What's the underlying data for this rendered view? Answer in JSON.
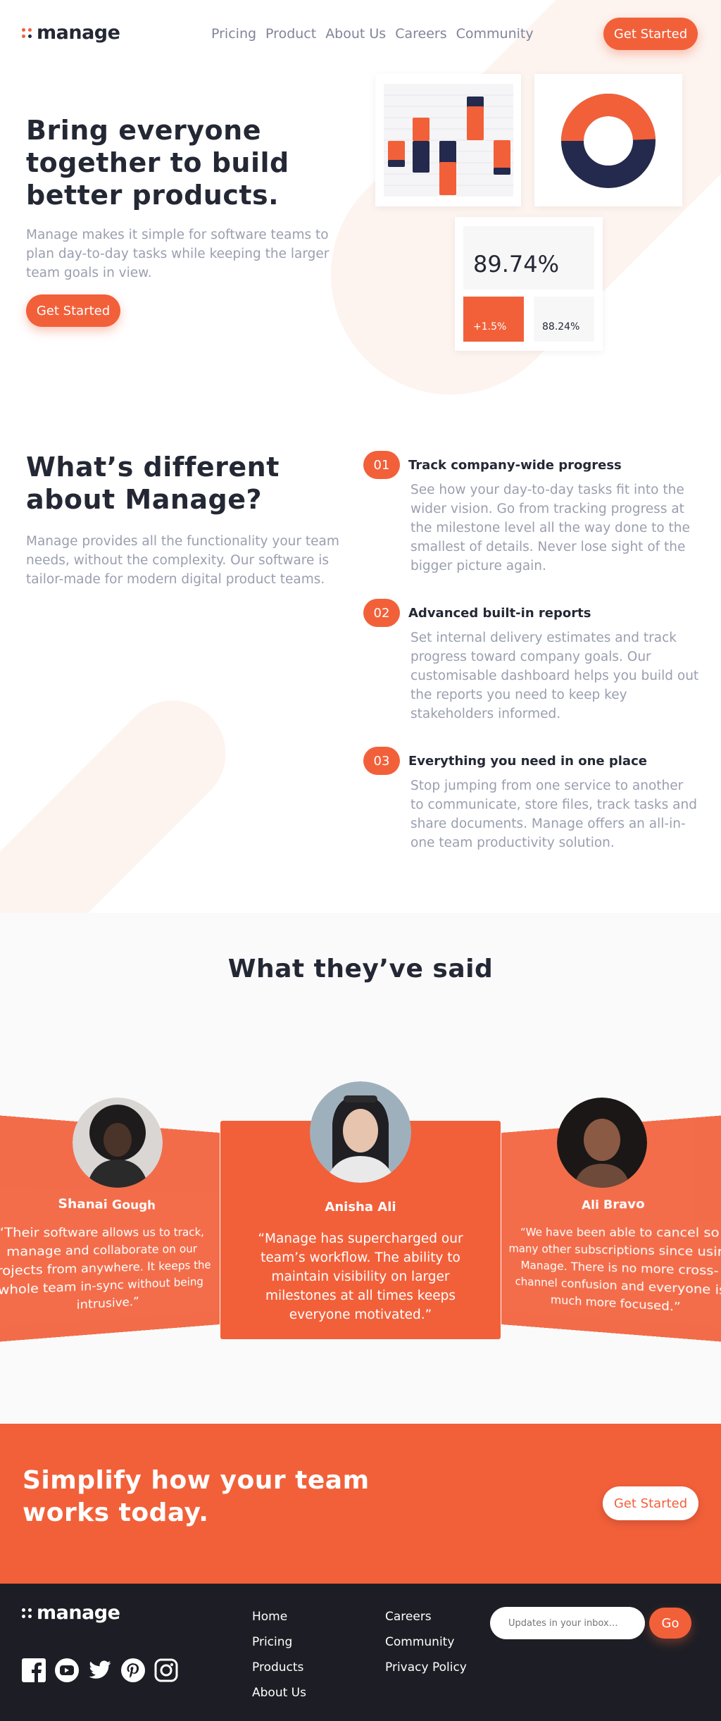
{
  "brand": {
    "name": "manage",
    "accent": "#f2603a",
    "dark": "#242835"
  },
  "nav": {
    "items": [
      "Pricing",
      "Product",
      "About Us",
      "Careers",
      "Community"
    ],
    "cta": "Get Started"
  },
  "hero": {
    "title": "Bring everyone together to build better products.",
    "description": "Manage makes it simple for software teams to plan day-to-day tasks while keeping the larger team goals in view.",
    "cta": "Get Started",
    "stats": {
      "big": "89.74%",
      "change": "+1.5%",
      "secondary": "88.24%"
    }
  },
  "features": {
    "title": "What’s different about Manage?",
    "description": "Manage provides all the functionality your team needs, without the complexity. Our software is tailor-made for modern digital product teams.",
    "items": [
      {
        "num": "01",
        "title": "Track company-wide progress",
        "desc": "See how your day-to-day tasks fit into the wider vision. Go from tracking progress at the milestone level all the way done to the smallest of details. Never lose sight of the bigger picture again."
      },
      {
        "num": "02",
        "title": "Advanced built-in reports",
        "desc": "Set internal delivery estimates and track progress toward company goals. Our customisable dashboard helps you build out the reports you need to keep key stakeholders informed."
      },
      {
        "num": "03",
        "title": "Everything you need in one place",
        "desc": "Stop jumping from one service to another to communicate, store files, track tasks and share documents. Manage offers an all-in-one team productivity solution."
      }
    ]
  },
  "testimonials": {
    "title": "What they’ve said",
    "items": [
      {
        "name": "Shanai Gough",
        "quote": "“Their software allows us to track, manage and collaborate on our projects from anywhere. It keeps the whole team in-sync without being intrusive.”"
      },
      {
        "name": "Anisha Ali",
        "quote": "“Manage has supercharged our team’s workflow. The ability to maintain visibility on larger milestones at all times keeps everyone motivated.”"
      },
      {
        "name": "Ali Bravo",
        "quote": "“We have been able to cancel so many other subscriptions since using Manage. There is no more cross-channel confusion and everyone is much more focused.”"
      }
    ]
  },
  "cta_band": {
    "title": "Simplify how your team works today.",
    "button": "Get Started"
  },
  "footer": {
    "logo": "manage",
    "col1": [
      "Home",
      "Pricing",
      "Products",
      "About Us"
    ],
    "col2": [
      "Careers",
      "Community",
      "Privacy Policy"
    ],
    "newsletter": {
      "placeholder": "Updates in your inbox…",
      "button": "Go"
    },
    "social": [
      "facebook-icon",
      "youtube-icon",
      "twitter-icon",
      "pinterest-icon",
      "instagram-icon"
    ]
  }
}
